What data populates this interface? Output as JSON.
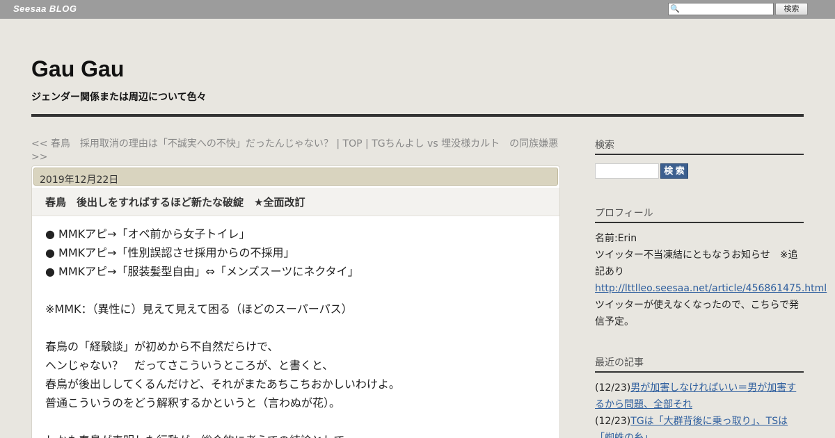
{
  "topbar": {
    "brand": "Seesaa BLOG",
    "search_placeholder": "",
    "search_button": "検索",
    "search_icon": "magnifier-icon"
  },
  "header": {
    "title": "Gau Gau",
    "description": "ジェンダー関係または周辺について色々"
  },
  "pager": {
    "prev": "<< 春鳥　採用取消の理由は「不誠実への不快」だったんじゃない？",
    "sep1": " | ",
    "top": "TOP",
    "sep2": " | ",
    "next": "TGちんよし vs 埋没様カルト　の同族嫌悪 >>"
  },
  "article": {
    "date": "2019年12月22日",
    "title": "春鳥　後出しをすればするほど新たな破綻　★全面改訂",
    "lines": [
      "● MMKアピ→「オペ前から女子トイレ」",
      "● MMKアピ→「性別誤認させ採用からの不採用」",
      "● MMKアピ→「服装髪型自由」⇔「メンズスーツにネクタイ」",
      "",
      "※MMK：（異性に）見えて見えて困る（ほどのスーパーパス）",
      "",
      "春鳥の「経験談」が初めから不自然だらけで、",
      "ヘンじゃない？　だってさこういうところが、と書くと、",
      "春鳥が後出ししてくるんだけど、それがまたあちこちおかしいわけよ。",
      "普通こういうのをどう解釈するかというと（言わぬが花）。",
      "",
      "しかも春鳥が表明した行動が、総合的に考えての結論として"
    ]
  },
  "sidebar": {
    "search": {
      "heading": "検索",
      "button": "検 索"
    },
    "profile": {
      "heading": "プロフィール",
      "name": "名前:Erin",
      "notice": "ツイッター不当凍結にともなうお知らせ　※追記あり",
      "link": "http://lttlleo.seesaa.net/article/456861475.html",
      "note": "ツイッターが使えなくなったので、こちらで発信予定。"
    },
    "recent": {
      "heading": "最近の記事",
      "items": [
        {
          "date": "(12/23)",
          "title": "男が加害しなければいい＝男が加害するから問題、全部それ"
        },
        {
          "date": "(12/23)",
          "title": "TGは「大群背後に乗っ取り」、TSは「蜘蛛の糸」"
        }
      ]
    }
  }
}
